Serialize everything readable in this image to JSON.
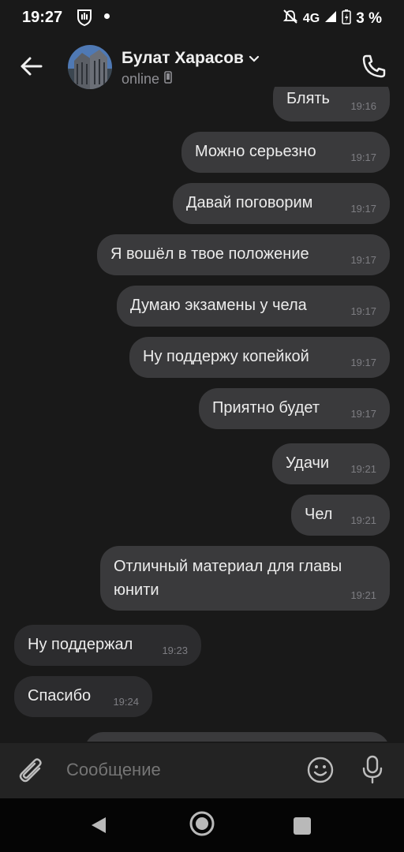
{
  "status_bar": {
    "time": "19:27",
    "network": "4G",
    "battery": "3 %"
  },
  "header": {
    "name": "Булат Харасов",
    "status": "online"
  },
  "messages": [
    {
      "text": "Блять",
      "time": "19:16",
      "dir": "out"
    },
    {
      "text": "Можно серьезно",
      "time": "19:17",
      "dir": "out"
    },
    {
      "text": "Давай поговорим",
      "time": "19:17",
      "dir": "out"
    },
    {
      "text": "Я вошёл в твое положение",
      "time": "19:17",
      "dir": "out"
    },
    {
      "text": "Думаю экзамены у чела",
      "time": "19:17",
      "dir": "out"
    },
    {
      "text": "Ну поддержу копейкой",
      "time": "19:17",
      "dir": "out"
    },
    {
      "text": "Приятно будет",
      "time": "19:17",
      "dir": "out"
    },
    {
      "text": "Удачи",
      "time": "19:21",
      "dir": "out"
    },
    {
      "text": "Чел",
      "time": "19:21",
      "dir": "out"
    },
    {
      "text": "Отличный материал для главы юнити",
      "time": "19:21",
      "dir": "out"
    },
    {
      "text": "Ну поддержал",
      "time": "19:23",
      "dir": "in"
    },
    {
      "text": "Спасибо",
      "time": "19:24",
      "dir": "in"
    }
  ],
  "input": {
    "placeholder": "Сообщение"
  },
  "icons": {
    "back": "arrow-left-icon",
    "call": "phone-icon",
    "attach": "paperclip-icon",
    "emoji": "smiley-icon",
    "mic": "microphone-icon"
  }
}
